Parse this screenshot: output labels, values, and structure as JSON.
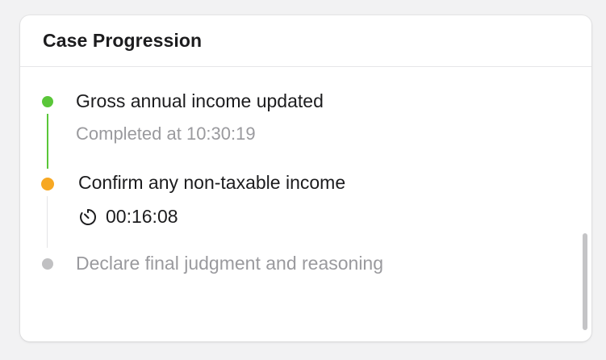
{
  "card": {
    "title": "Case Progression"
  },
  "steps": [
    {
      "title": "Gross annual income updated",
      "status": "completed",
      "detail": "Completed at 10:30:19",
      "dot_color": "#5ac639"
    },
    {
      "title": "Confirm any non-taxable income",
      "status": "in-progress",
      "timer": "00:16:08",
      "icon": "timer-icon",
      "dot_color": "#f7a823"
    },
    {
      "title": "Declare final judgment and reasoning",
      "status": "pending",
      "dot_color": "#c0c0c2"
    }
  ],
  "colors": {
    "completed_line": "#5ac639",
    "pending_line": "#dcdcde",
    "title_active": "#1c1c1e",
    "title_pending": "#9a9a9e"
  }
}
